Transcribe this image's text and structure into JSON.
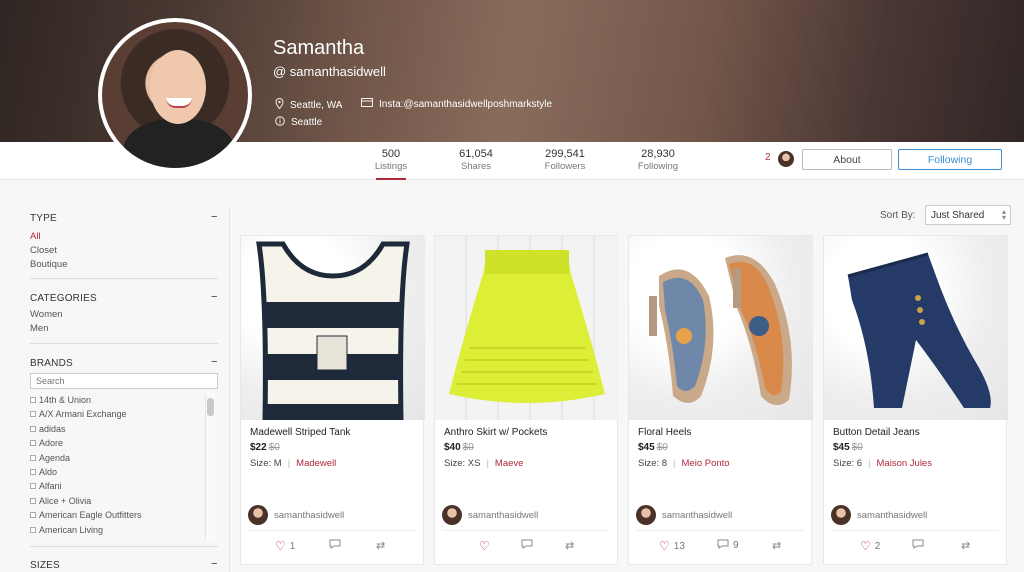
{
  "profile": {
    "name": "Samantha",
    "handle": "@ samanthasidwell",
    "location": "Seattle, WA",
    "insta": "Insta:@samanthasidwellposhmarkstyle",
    "city": "Seattle",
    "icons": {
      "location": "location-pin-icon",
      "insta": "card-icon",
      "info": "info-icon"
    }
  },
  "stats": [
    {
      "value": "500",
      "label": "Listings"
    },
    {
      "value": "61,054",
      "label": "Shares"
    },
    {
      "value": "299,541",
      "label": "Followers"
    },
    {
      "value": "28,930",
      "label": "Following"
    }
  ],
  "mini_count": "2",
  "buttons": {
    "about": "About",
    "following": "Following"
  },
  "sort": {
    "label": "Sort By:",
    "value": "Just Shared"
  },
  "sidebar": {
    "type": {
      "title": "TYPE",
      "toggle": "−",
      "items": [
        "All",
        "Closet",
        "Boutique"
      ],
      "active": "All"
    },
    "categories": {
      "title": "CATEGORIES",
      "toggle": "−",
      "items": [
        "Women",
        "Men"
      ]
    },
    "brands": {
      "title": "BRANDS",
      "toggle": "−",
      "search_placeholder": "Search",
      "items": [
        "14th & Union",
        "A/X Armani Exchange",
        "adidas",
        "Adore",
        "Agenda",
        "Aldo",
        "Alfani",
        "Alice + Olivia",
        "American Eagle Outfitters",
        "American Living"
      ]
    },
    "sizes": {
      "title": "SIZES",
      "toggle": "−"
    }
  },
  "listings": [
    {
      "title": "Madewell Striped Tank",
      "price": "$22",
      "orig": "$0",
      "size": "Size: M",
      "brand": "Madewell",
      "seller": "samanthasidwell",
      "likes": "1",
      "comments": "",
      "image": "striped-tank"
    },
    {
      "title": "Anthro Skirt w/ Pockets",
      "price": "$40",
      "orig": "$0",
      "size": "Size: XS",
      "brand": "Maeve",
      "seller": "samanthasidwell",
      "likes": "",
      "comments": "",
      "image": "yellow-skirt"
    },
    {
      "title": "Floral Heels",
      "price": "$45",
      "orig": "$0",
      "size": "Size: 8",
      "brand": "Meio Ponto",
      "seller": "samanthasidwell",
      "likes": "13",
      "comments": "9",
      "image": "floral-heels"
    },
    {
      "title": "Button Detail Jeans",
      "price": "$45",
      "orig": "$0",
      "size": "Size: 6",
      "brand": "Maison Jules",
      "seller": "samanthasidwell",
      "likes": "2",
      "comments": "",
      "image": "blue-jeans"
    }
  ],
  "colors": {
    "accent": "#b0293f",
    "follow": "#3d8fd1"
  }
}
